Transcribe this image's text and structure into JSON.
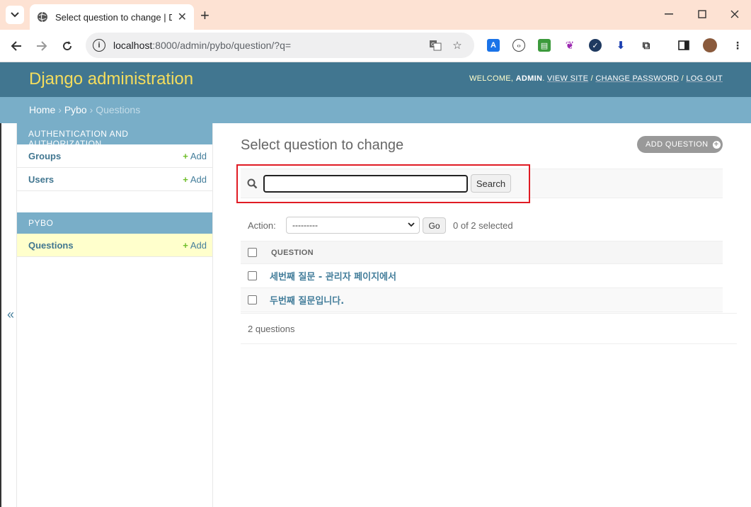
{
  "browser": {
    "tab_title": "Select question to change | Dj",
    "url_host": "localhost",
    "url_rest": ":8000/admin/pybo/question/?q=",
    "icons": [
      "tab-search-icon",
      "globe-icon",
      "close-icon",
      "new-tab-icon",
      "minimize-icon",
      "maximize-icon",
      "window-close-icon",
      "back-icon",
      "forward-icon",
      "reload-icon",
      "site-info-icon",
      "translate-icon",
      "bookmark-star-icon",
      "extensions-icon",
      "sidebar-icon",
      "profile-avatar",
      "menu-icon"
    ]
  },
  "header": {
    "brand": "Django administration",
    "welcome": "WELCOME,",
    "user": "ADMIN",
    "view_site": "VIEW SITE",
    "change_password": "CHANGE PASSWORD",
    "log_out": "LOG OUT",
    "separator": "/"
  },
  "breadcrumbs": {
    "home": "Home",
    "app": "Pybo",
    "current": "Questions",
    "sep": "›"
  },
  "sidebar": {
    "collapse_label": "«",
    "modules": [
      {
        "caption": "Authentication and Authorization",
        "items": [
          {
            "name": "Groups",
            "add": "Add"
          },
          {
            "name": "Users",
            "add": "Add"
          }
        ]
      },
      {
        "caption": "Pybo",
        "items": [
          {
            "name": "Questions",
            "add": "Add"
          }
        ]
      }
    ]
  },
  "main": {
    "title": "Select question to change",
    "add_button": "ADD QUESTION",
    "search": {
      "value": "",
      "button": "Search"
    },
    "actions": {
      "label": "Action:",
      "selected_option": "---------",
      "go": "Go",
      "counter": "0 of 2 selected"
    },
    "table": {
      "column": "Question",
      "rows": [
        "세번째 질문 - 관리자 페이지에서",
        "두번째 질문입니다."
      ]
    },
    "paginator": "2 questions"
  },
  "colors": {
    "header_bg": "#417690",
    "brand": "#f5dd5d",
    "breadcrumb_bg": "#79aec8",
    "link": "#447e9b",
    "add_green": "#70bf2b",
    "highlight_red": "#e01b24"
  }
}
